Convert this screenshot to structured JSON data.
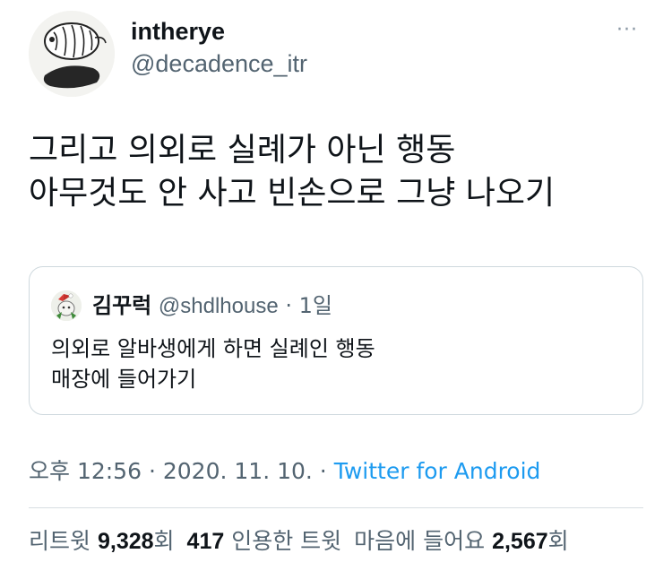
{
  "author": {
    "display_name": "intherye",
    "handle": "@decadence_itr"
  },
  "menu": {
    "more_icon": "more-horizontal-icon",
    "more_label": "···"
  },
  "tweet": {
    "lines": [
      "그리고 의외로 실례가 아닌 행동",
      "아무것도 안 사고 빈손으로 그냥 나오기"
    ]
  },
  "quote": {
    "display_name": "김꾸럭",
    "handle": "@shdlhouse",
    "separator": "·",
    "time": "1일",
    "lines": [
      "의외로 알바생에게 하면 실례인 행동",
      "매장에 들어가기"
    ]
  },
  "meta": {
    "time": "오후 12:56",
    "separator": "·",
    "date": "2020. 11. 10.",
    "separator2": "·",
    "source": "Twitter for Android"
  },
  "stats": {
    "retweets_label": "리트윗",
    "retweets_count": "9,328",
    "retweets_suffix": "회",
    "quotes_count": "417",
    "quotes_label": "인용한 트윗",
    "likes_label": "마음에 들어요",
    "likes_count": "2,567",
    "likes_suffix": "회"
  },
  "colors": {
    "text": "#0f1419",
    "secondary": "#536471",
    "link": "#1d9bf0",
    "border": "#cfd9de"
  }
}
